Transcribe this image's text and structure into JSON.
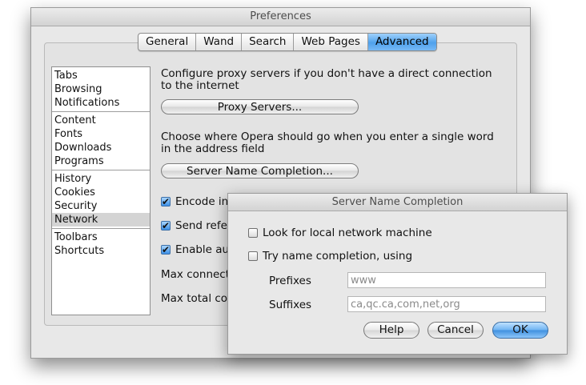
{
  "window": {
    "title": "Preferences"
  },
  "tabs": [
    {
      "label": "General"
    },
    {
      "label": "Wand"
    },
    {
      "label": "Search"
    },
    {
      "label": "Web Pages"
    },
    {
      "label": "Advanced",
      "active": true
    }
  ],
  "sidebar": {
    "groups": [
      [
        "Tabs",
        "Browsing",
        "Notifications"
      ],
      [
        "Content",
        "Fonts",
        "Downloads",
        "Programs"
      ],
      [
        "History",
        "Cookies",
        "Security",
        "Network"
      ],
      [
        "Toolbars",
        "Shortcuts"
      ]
    ],
    "selected": "Network"
  },
  "network": {
    "proxy_text": "Configure proxy servers if you don't have a direct connection to the internet",
    "proxy_button": "Proxy Servers...",
    "completion_text": "Choose where Opera should go when you enter a single word in the address field",
    "completion_button": "Server Name Completion...",
    "options": [
      {
        "label": "Encode int",
        "checked": true
      },
      {
        "label": "Send refer",
        "checked": true
      },
      {
        "label": "Enable aut",
        "checked": true
      }
    ],
    "max_conn_label": "Max connecti",
    "max_total_label": "Max total cor"
  },
  "dialog": {
    "title": "Server Name Completion",
    "look_local": {
      "label": "Look for local network machine",
      "checked": false
    },
    "try_completion": {
      "label": "Try name completion, using",
      "checked": false
    },
    "prefixes_label": "Prefixes",
    "prefixes_value": "www",
    "suffixes_label": "Suffixes",
    "suffixes_value": "ca,qc.ca,com,net,org",
    "help_button": "Help",
    "cancel_button": "Cancel",
    "ok_button": "OK"
  },
  "colors": {
    "accent": "#4fa1ec",
    "selection": "#d4d4d4"
  }
}
